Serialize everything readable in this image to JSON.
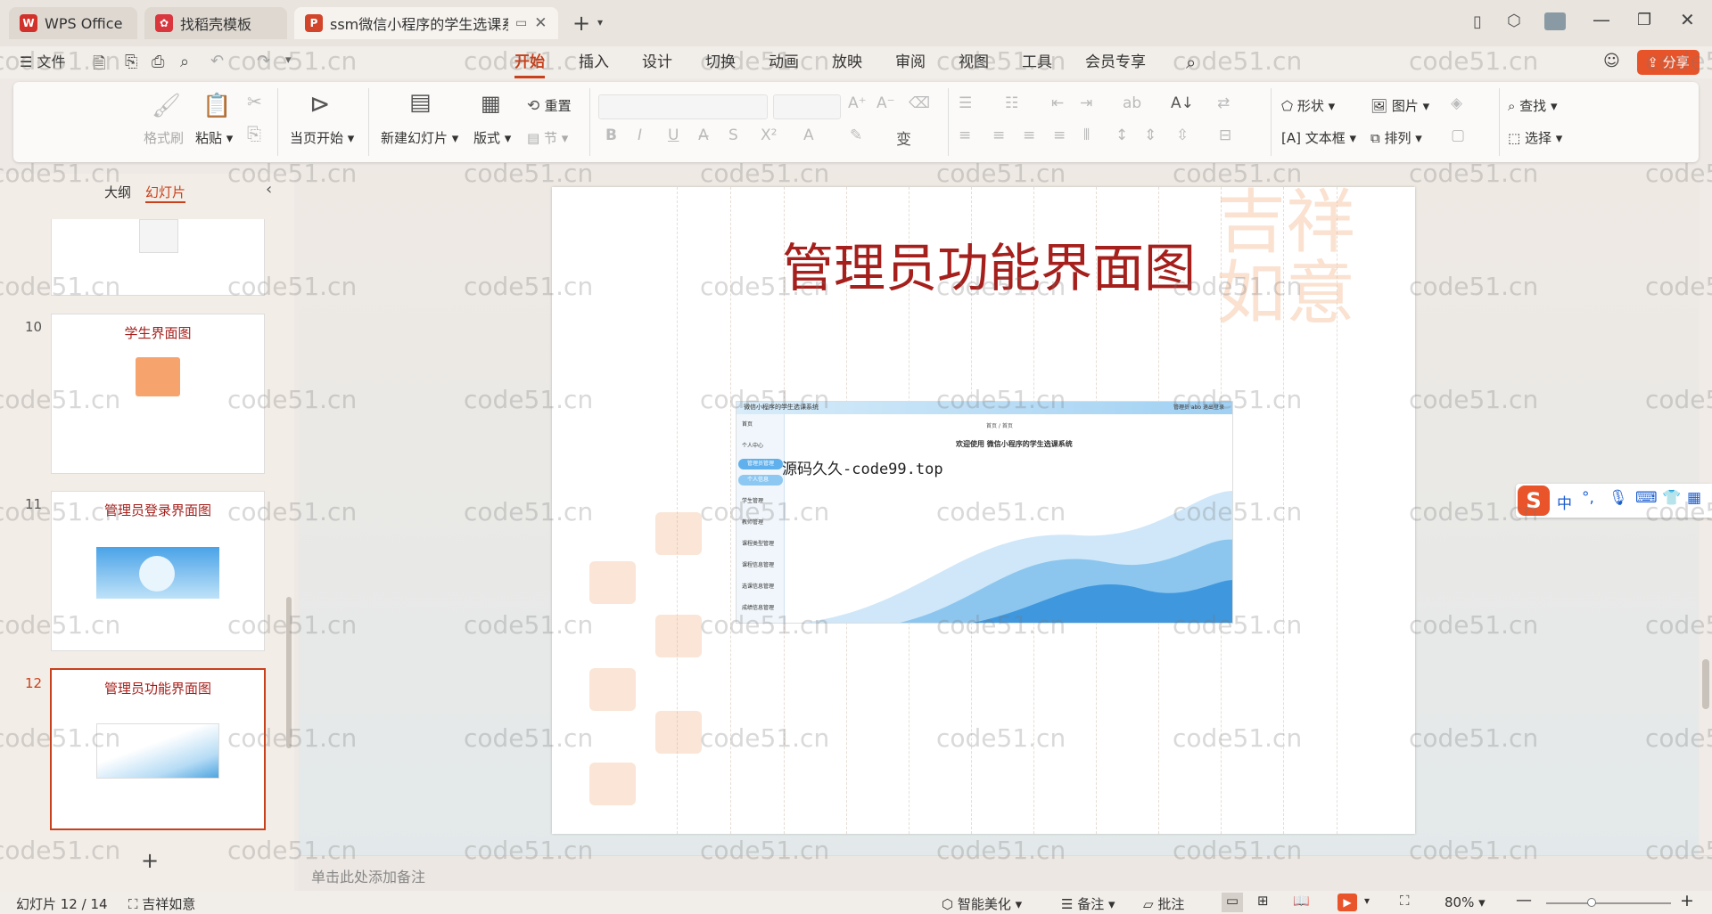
{
  "tabs": [
    {
      "label": "WPS Office",
      "icon": "wps-logo-icon"
    },
    {
      "label": "找稻壳模板",
      "icon": "docer-icon"
    },
    {
      "label": "ssm微信小程序的学生选课系统",
      "icon": "ppt-icon"
    }
  ],
  "menu": {
    "file": "文件",
    "items": [
      "开始",
      "插入",
      "设计",
      "切换",
      "动画",
      "放映",
      "审阅",
      "视图",
      "工具",
      "会员专享"
    ],
    "active": "开始",
    "share": "分享"
  },
  "ribbon": {
    "format_painter": "格式刷",
    "paste": "粘贴",
    "play_from_current": "当页开始",
    "new_slide": "新建幻灯片",
    "layout": "版式",
    "reset": "重置",
    "section": "节",
    "shape": "形状",
    "picture": "图片",
    "find": "查找",
    "textbox": "文本框",
    "arrange": "排列",
    "select": "选择"
  },
  "panel": {
    "tab_outline": "大纲",
    "tab_slides": "幻灯片",
    "thumbs": [
      {
        "num": "10",
        "title": "学生界面图"
      },
      {
        "num": "11",
        "title": "管理员登录界面图"
      },
      {
        "num": "12",
        "title": "管理员功能界面图"
      }
    ]
  },
  "slide": {
    "title": "管理员功能界面图",
    "screenshot_header": "微信小程序的学生选课系统",
    "screenshot_welcome": "欢迎使用 微信小程序的学生选课系统",
    "screenshot_breadcrumb": "首页 / 首页",
    "screenshot_user": "管理员 abo   退出登录",
    "overlay_text": "源码久久-code99.top",
    "side_items": [
      "首页",
      "个人中心",
      "管理员管理",
      "个人信息",
      "学生管理",
      "教师管理",
      "课程类型管理",
      "课程信息管理",
      "选课信息管理",
      "成绩信息管理"
    ]
  },
  "notes_placeholder": "单击此处添加备注",
  "status": {
    "slide_count": "幻灯片 12 / 14",
    "theme": "吉祥如意",
    "beautify": "智能美化",
    "notes": "备注",
    "comments": "批注",
    "zoom": "80%"
  },
  "ime": {
    "lang": "中"
  },
  "watermark": "code51.cn",
  "colors": {
    "accent": "#c8401c",
    "title_red": "#a5201c"
  }
}
